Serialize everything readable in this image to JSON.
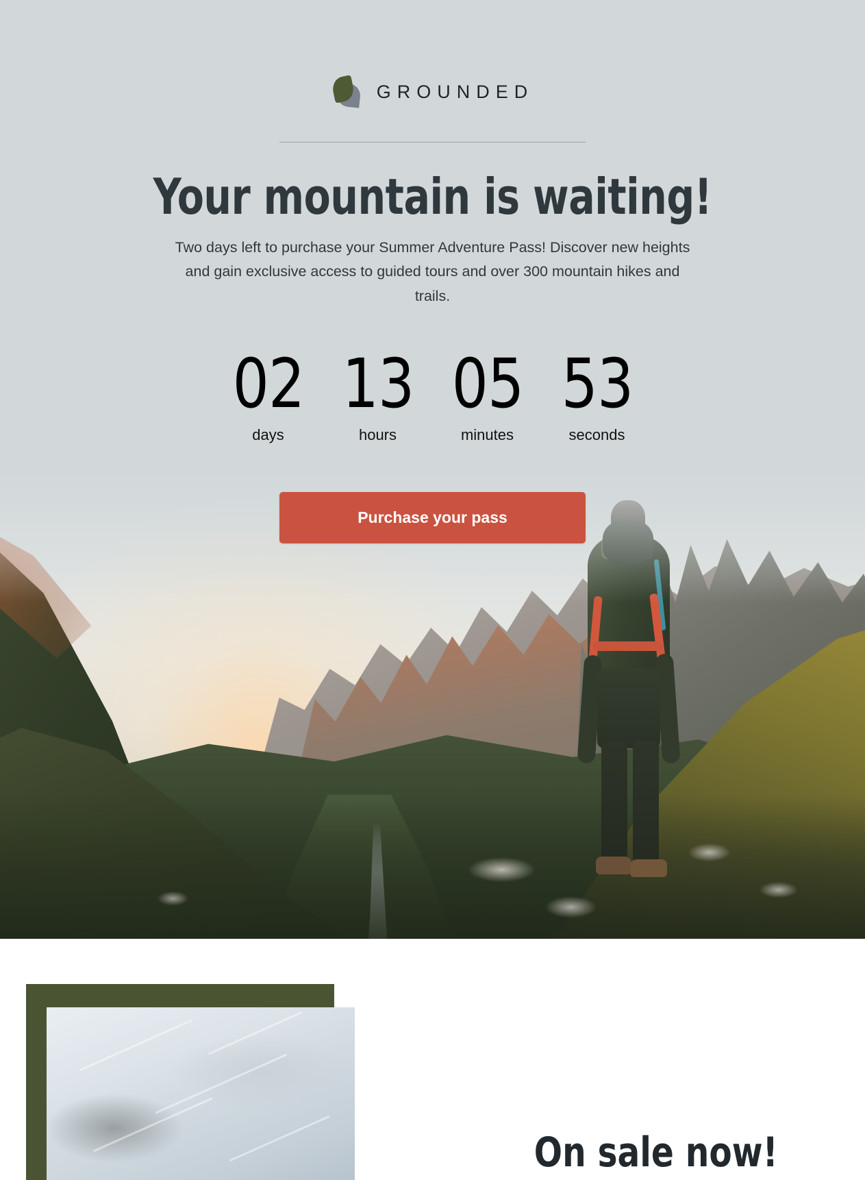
{
  "brand": {
    "name": "GROUNDED",
    "logo_icon": "leaf-icon"
  },
  "hero": {
    "headline": "Your mountain is waiting!",
    "subcopy": "Two days left to purchase your Summer Adventure Pass! Discover new heights and gain exclusive access to guided tours and over 300 mountain hikes and trails.",
    "cta_label": "Purchase your pass",
    "countdown": {
      "units": [
        {
          "value": "02",
          "label": "days"
        },
        {
          "value": "13",
          "label": "hours"
        },
        {
          "value": "05",
          "label": "minutes"
        },
        {
          "value": "53",
          "label": "seconds"
        }
      ]
    },
    "image_alt": "hiker-with-backpack-overlooking-mountain-valley"
  },
  "section_two": {
    "heading": "On sale now!",
    "image_alt": "snowy-mountain-photo"
  },
  "colors": {
    "hero_background": "#d2d8da",
    "cta_background": "#ca5240",
    "cta_text": "#ffffff",
    "headline_text": "#2f383d",
    "body_text": "#2f383d",
    "countdown_value": "#000000",
    "divider": "#9aa4a8",
    "logo_leaf_green": "#4e5a34",
    "logo_leaf_gray": "#7a828d",
    "frame_green": "#4a5433",
    "page_background": "#ffffff"
  }
}
